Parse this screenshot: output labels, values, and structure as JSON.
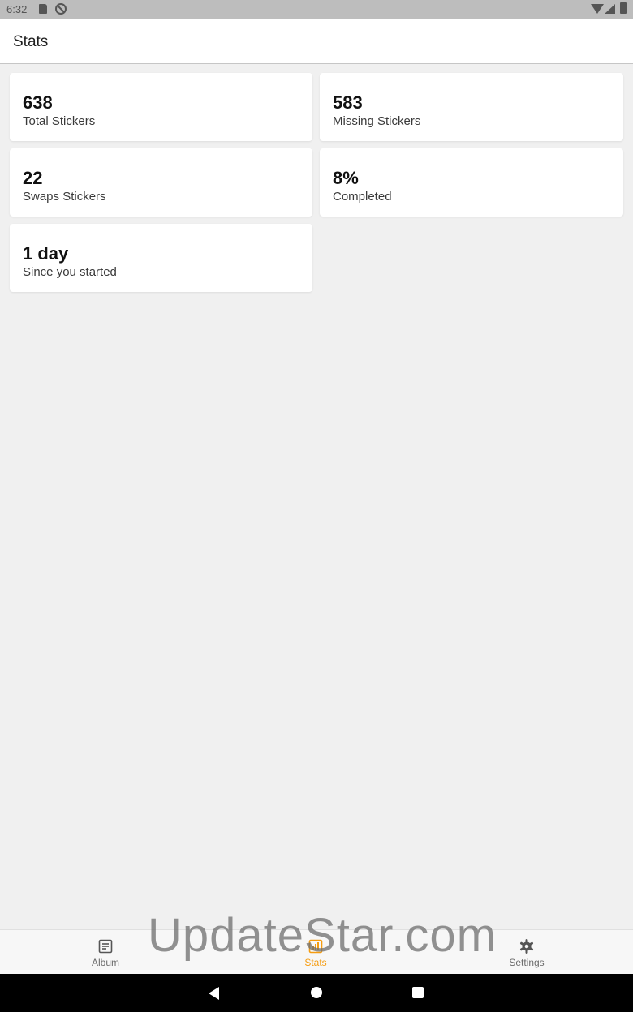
{
  "status_bar": {
    "time": "6:32"
  },
  "app_bar": {
    "title": "Stats"
  },
  "stats": [
    {
      "value": "638",
      "label": "Total Stickers"
    },
    {
      "value": "583",
      "label": "Missing Stickers"
    },
    {
      "value": "22",
      "label": "Swaps Stickers"
    },
    {
      "value": "8%",
      "label": "Completed"
    },
    {
      "value": "1 day",
      "label": "Since you started"
    }
  ],
  "bottom_nav": {
    "items": [
      {
        "label": "Album",
        "icon": "album-icon"
      },
      {
        "label": "Stats",
        "icon": "stats-icon",
        "active": true
      },
      {
        "label": "Settings",
        "icon": "gear-icon"
      }
    ],
    "active_color": "#f59c10"
  },
  "watermark": "UpdateStar.com"
}
